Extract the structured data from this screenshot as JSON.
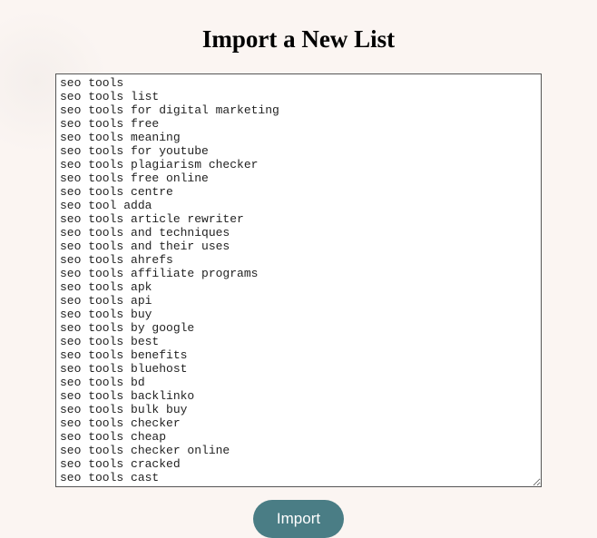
{
  "page": {
    "title": "Import a New List"
  },
  "form": {
    "listValue": "seo tools\nseo tools list\nseo tools for digital marketing\nseo tools free\nseo tools meaning\nseo tools for youtube\nseo tools plagiarism checker\nseo tools free online\nseo tools centre\nseo tool adda\nseo tools article rewriter\nseo tools and techniques\nseo tools and their uses\nseo tools ahrefs\nseo tools affiliate programs\nseo tools apk\nseo tools api\nseo tools buy\nseo tools by google\nseo tools best\nseo tools benefits\nseo tools bluehost\nseo tools bd\nseo tools backlinko\nseo tools bulk buy\nseo tools checker\nseo tools cheap\nseo tools checker online\nseo tools cracked\nseo tools cast"
  },
  "buttons": {
    "importLabel": "Import"
  },
  "colors": {
    "background": "#fbf5f2",
    "buttonBg": "#4a7d85",
    "buttonText": "#ffffff"
  }
}
